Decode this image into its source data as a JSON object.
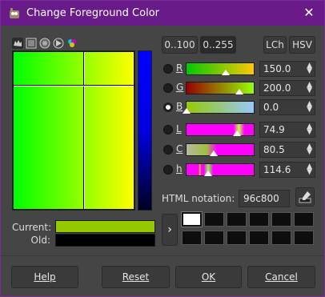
{
  "window": {
    "title": "Change Foreground Color",
    "accent": "#6a1b8a"
  },
  "selector_tabs": [
    "wilber-icon",
    "scales-icon",
    "watercolor-icon",
    "triangle-icon",
    "cmyk-icon"
  ],
  "range_buttons": {
    "range_100": "0..100",
    "range_255": "0..255"
  },
  "mode_buttons": {
    "lch": "LCh",
    "hsv": "HSV"
  },
  "channels": [
    {
      "key": "R",
      "value": "150.0",
      "fraction": 0.588
    },
    {
      "key": "G",
      "value": "200.0",
      "fraction": 0.784
    },
    {
      "key": "B",
      "value": "0.0",
      "fraction": 0.0,
      "selected": true
    },
    {
      "key": "L",
      "value": "74.9",
      "fraction": 0.749
    },
    {
      "key": "C",
      "value": "80.5",
      "fraction": 0.402
    },
    {
      "key": "h",
      "value": "114.6",
      "fraction": 0.318
    }
  ],
  "html_notation": {
    "label": "HTML notation:",
    "value": "96c800"
  },
  "current_label": "Current:",
  "old_label": "Old:",
  "current_color": "#96c800",
  "old_color": "#000000",
  "add_history_icon": "chevron-right-icon",
  "buttons": {
    "help": "Help",
    "reset": "Reset",
    "ok": "OK",
    "cancel": "Cancel"
  }
}
